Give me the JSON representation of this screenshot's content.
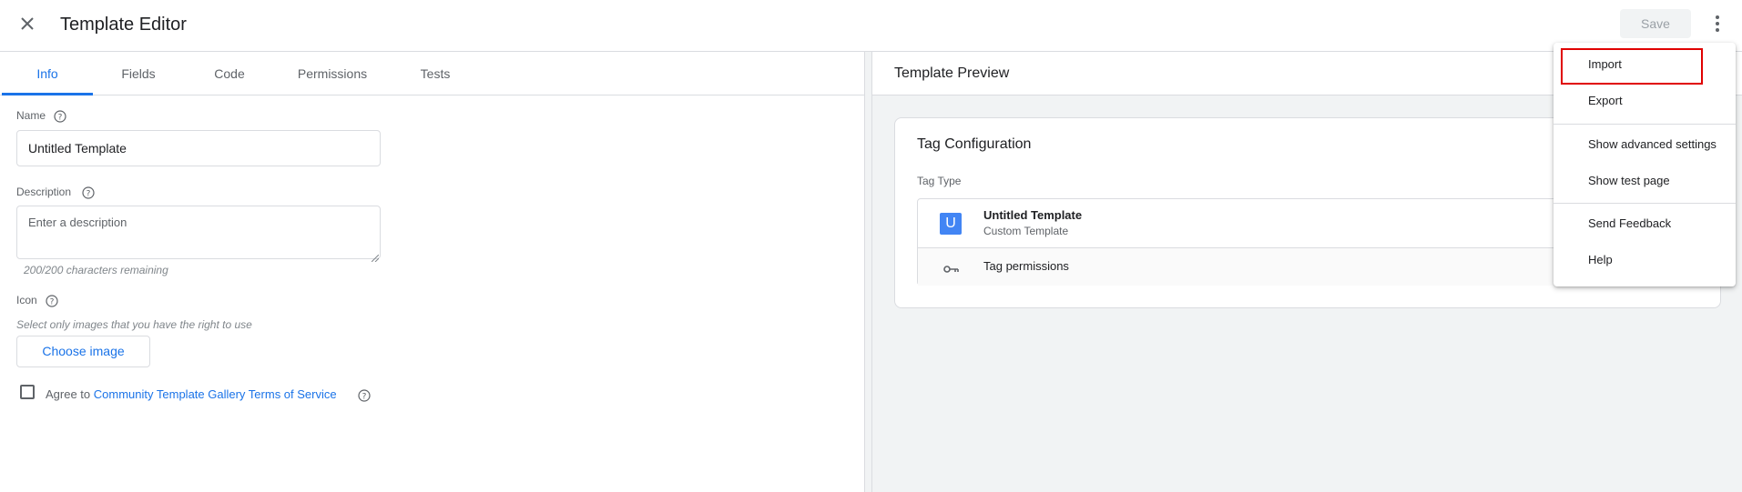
{
  "header": {
    "title": "Template Editor",
    "save_label": "Save",
    "close_icon": "close-icon",
    "more_icon": "more-vert-icon"
  },
  "tabs": [
    {
      "label": "Info",
      "active": true
    },
    {
      "label": "Fields",
      "active": false
    },
    {
      "label": "Code",
      "active": false
    },
    {
      "label": "Permissions",
      "active": false
    },
    {
      "label": "Tests",
      "active": false
    }
  ],
  "info": {
    "name_label": "Name",
    "name_value": "Untitled Template",
    "description_label": "Description",
    "description_placeholder": "Enter a description",
    "char_remaining": "200/200 characters remaining",
    "icon_label": "Icon",
    "icon_hint": "Select only images that you have the right to use",
    "choose_image_label": "Choose image",
    "agree_prefix": "Agree to",
    "agree_link": "Community Template Gallery Terms of Service",
    "help_icon": "help-circle-icon"
  },
  "preview": {
    "title": "Template Preview",
    "card_title": "Tag Configuration",
    "tag_type_label": "Tag Type",
    "tag_letter": "U",
    "tag_name": "Untitled Template",
    "tag_kind": "Custom Template",
    "permissions_label": "Tag permissions",
    "key_icon": "key-icon"
  },
  "menu": {
    "items": [
      {
        "label": "Import",
        "highlighted": true
      },
      {
        "label": "Export"
      },
      {
        "label": "Show advanced settings"
      },
      {
        "label": "Show test page"
      },
      {
        "label": "Send Feedback"
      },
      {
        "label": "Help"
      }
    ]
  },
  "colors": {
    "accent": "#1a73e8",
    "highlight": "#e00000",
    "tag_icon_bg": "#4285f4"
  }
}
